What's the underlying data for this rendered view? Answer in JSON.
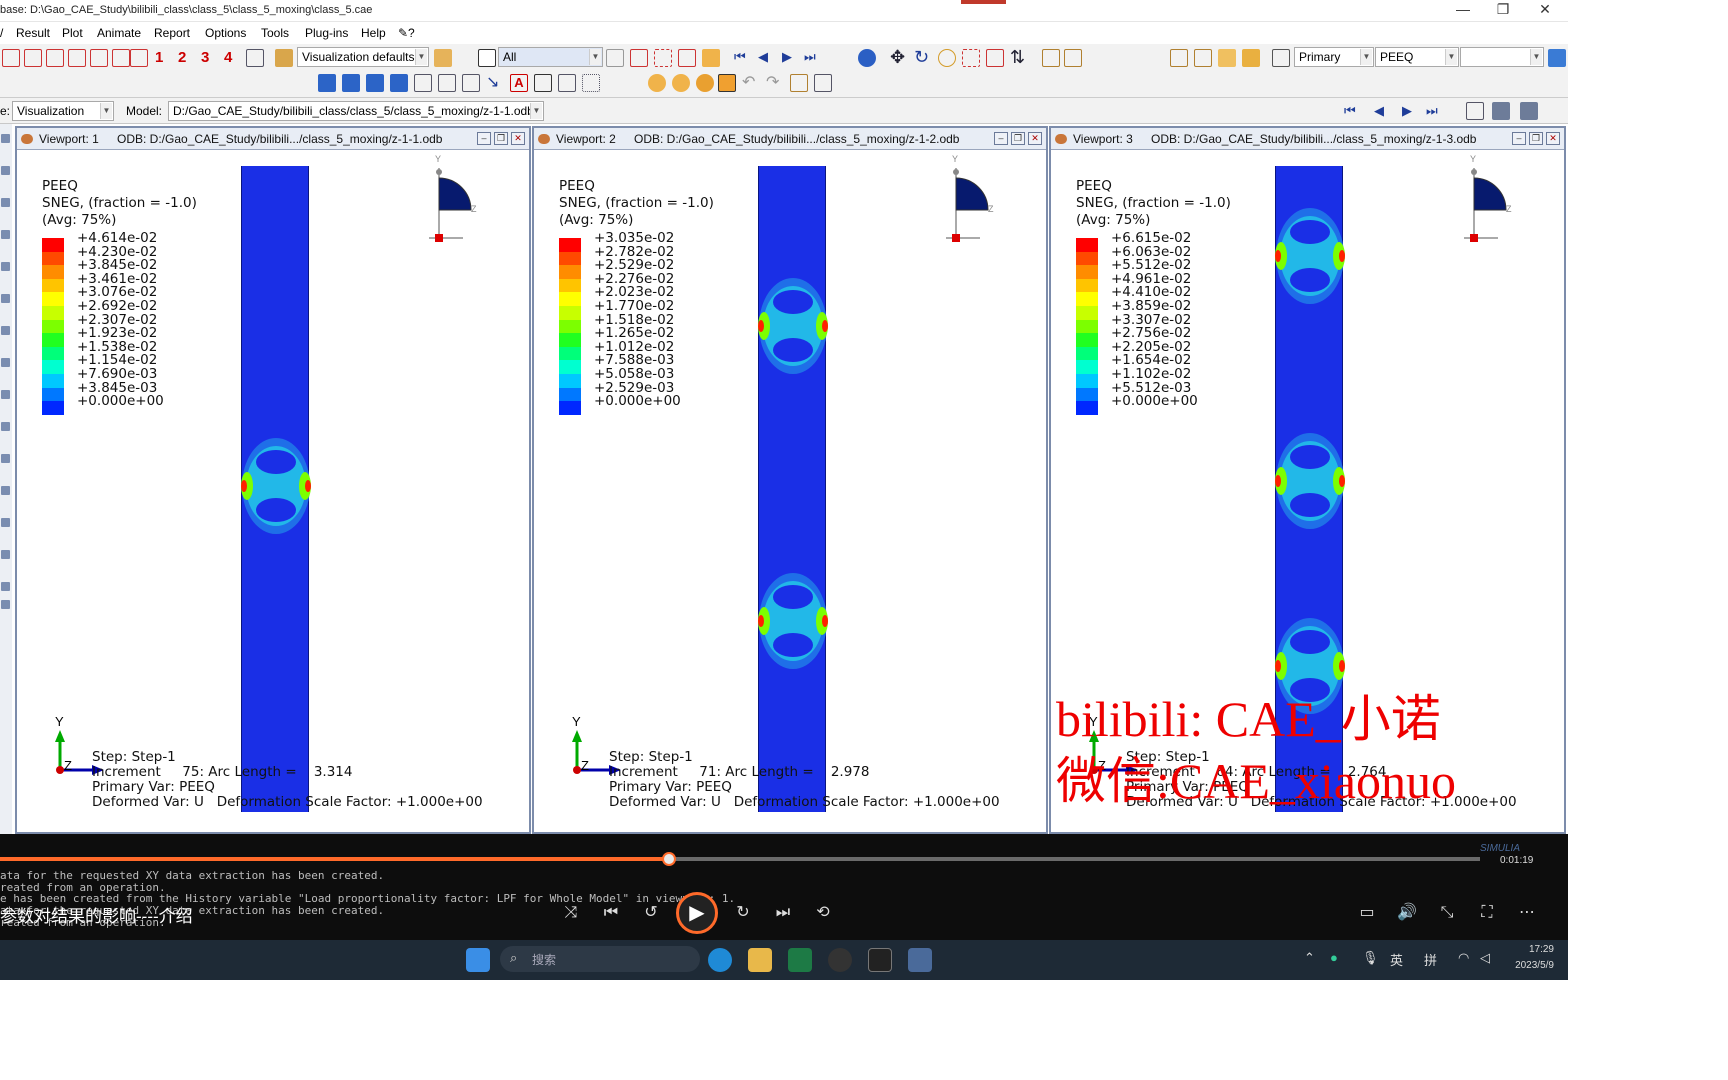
{
  "window": {
    "title": "base: D:\\Gao_CAE_Study\\bilibili_class\\class_5\\class_5_moxing\\class_5.cae",
    "minimize": "—",
    "maximize": "❐",
    "close": "✕"
  },
  "menu": [
    "Result",
    "Plot",
    "Animate",
    "Report",
    "Options",
    "Tools",
    "Plug-ins",
    "Help",
    "✎?"
  ],
  "toolbar": {
    "render_style": "Visualization defaults",
    "selection": "All",
    "numbers": [
      "1",
      "2",
      "3",
      "4"
    ],
    "primary": "Primary",
    "variable": "PEEQ",
    "component": ""
  },
  "context": {
    "module_label": "e:",
    "module": "Visualization",
    "model_label": "Model:",
    "model": "D:/Gao_CAE_Study/bilibili_class/class_5/class_5_moxing/z-1-1.odb"
  },
  "legend_header": {
    "var": "PEEQ",
    "sneg": "SNEG, (fraction = -1.0)",
    "avg": "(Avg: 75%)"
  },
  "colors": {
    "bar_blue": "#1a2fe6",
    "viewport_border": "#7c8cab",
    "accent": "#ff6a2a",
    "watermark": "#ee0000"
  },
  "colormap": [
    "#ff0000",
    "#ff4a00",
    "#ff8c00",
    "#ffc400",
    "#ffff00",
    "#c8ff00",
    "#7cff00",
    "#20ff20",
    "#00ff7a",
    "#00ffd0",
    "#00c8ff",
    "#0078ff",
    "#0028ff"
  ],
  "triad_labels": {
    "y": "Y",
    "z": "Z"
  },
  "viewports": [
    {
      "name": "Viewport: 1",
      "odb": "ODB: D:/Gao_CAE_Study/bilibili.../class_5_moxing/z-1-1.odb",
      "values": [
        "+4.614e-02",
        "+4.230e-02",
        "+3.845e-02",
        "+3.461e-02",
        "+3.076e-02",
        "+2.692e-02",
        "+2.307e-02",
        "+1.923e-02",
        "+1.538e-02",
        "+1.154e-02",
        "+7.690e-03",
        "+3.845e-03",
        "+0.000e+00"
      ],
      "step": "Step: Step-1",
      "increment": "Increment     75: Arc Length =    3.314",
      "primary": "Primary Var: PEEQ",
      "deformed": "Deformed Var: U   Deformation Scale Factor: +1.000e+00"
    },
    {
      "name": "Viewport: 2",
      "odb": "ODB: D:/Gao_CAE_Study/bilibili.../class_5_moxing/z-1-2.odb",
      "values": [
        "+3.035e-02",
        "+2.782e-02",
        "+2.529e-02",
        "+2.276e-02",
        "+2.023e-02",
        "+1.770e-02",
        "+1.518e-02",
        "+1.265e-02",
        "+1.012e-02",
        "+7.588e-03",
        "+5.058e-03",
        "+2.529e-03",
        "+0.000e+00"
      ],
      "step": "Step: Step-1",
      "increment": "Increment     71: Arc Length =    2.978",
      "primary": "Primary Var: PEEQ",
      "deformed": "Deformed Var: U   Deformation Scale Factor: +1.000e+00"
    },
    {
      "name": "Viewport: 3",
      "odb": "ODB: D:/Gao_CAE_Study/bilibili.../class_5_moxing/z-1-3.odb",
      "values": [
        "+6.615e-02",
        "+6.063e-02",
        "+5.512e-02",
        "+4.961e-02",
        "+4.410e-02",
        "+3.859e-02",
        "+3.307e-02",
        "+2.756e-02",
        "+2.205e-02",
        "+1.654e-02",
        "+1.102e-02",
        "+5.512e-03",
        "+0.000e+00"
      ],
      "step": "Step: Step-1",
      "increment": "Increment     64: Arc Length =    2.764",
      "primary": "Primary Var: PEEQ",
      "deformed": "Deformed Var: U   Deformation Scale Factor: +1.000e+00"
    }
  ],
  "watermark": {
    "line1": "bilibili:  CAE_小诺",
    "line2": "微信:CAE_xiaonuo"
  },
  "player": {
    "console": [
      "ata for the requested XY data extraction has been created.",
      "reated from an operation.",
      "e has been created from the History variable \"Load proportionality factor: LPF for Whole Model\" in viewport: 1.",
      "ata for the requested XY data extraction has been created.",
      "reated from an operation."
    ],
    "title": "参数对结果的影响----介绍",
    "time": "0:01:19",
    "logo": "SIMULIA"
  },
  "taskbar": {
    "search": "搜索",
    "ime1": "英",
    "ime2": "拼",
    "clock_time": "17:29",
    "clock_date": "2023/5/9"
  }
}
